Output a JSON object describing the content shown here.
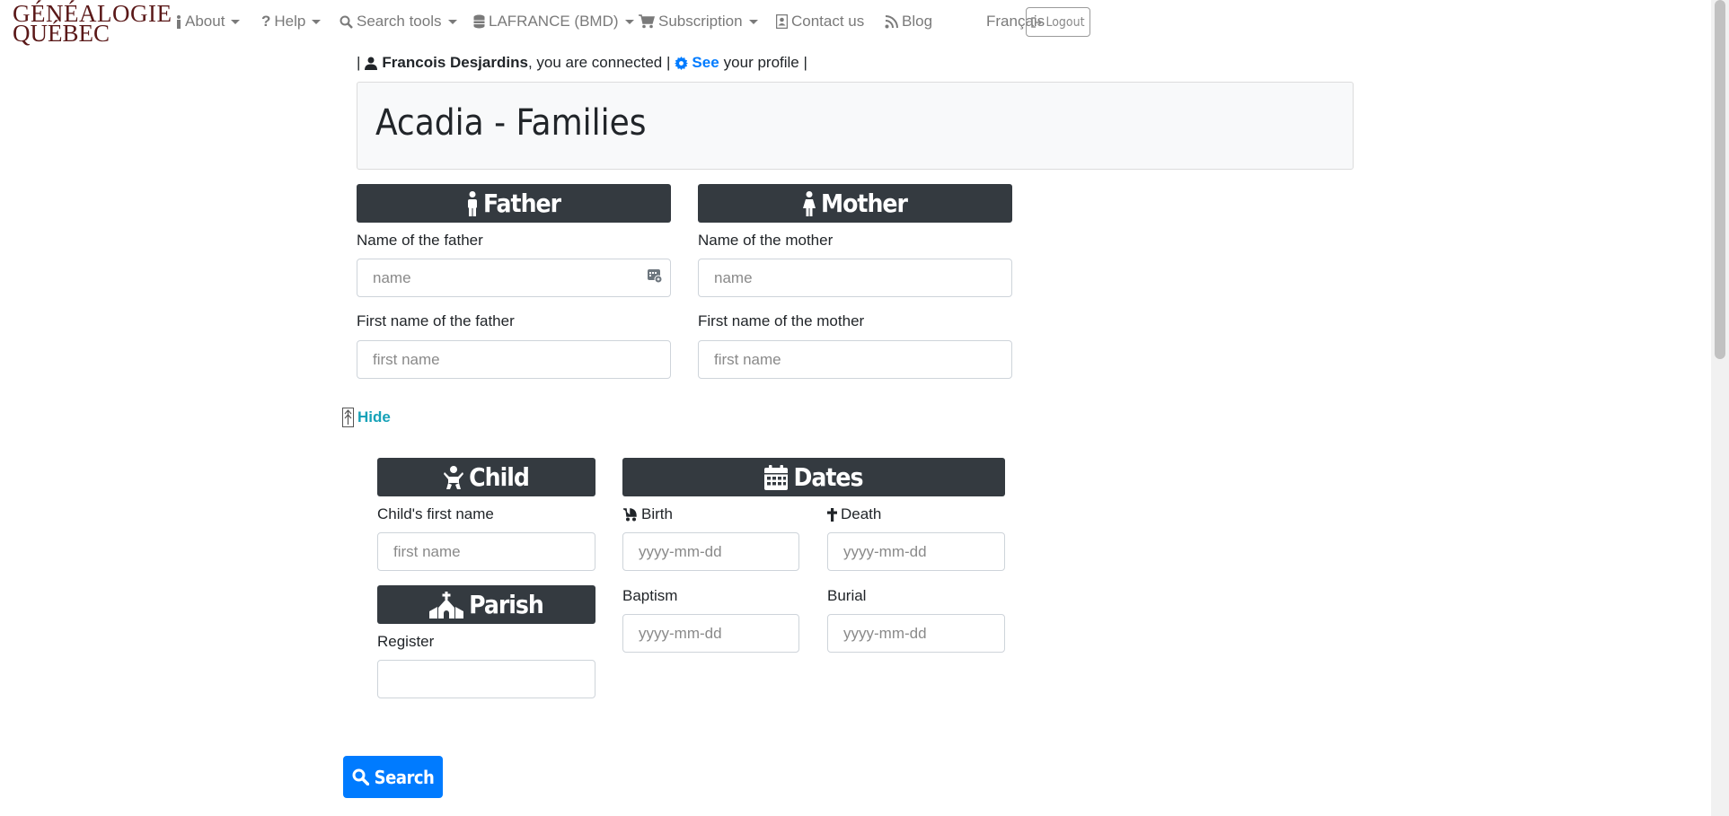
{
  "logo": {
    "line1": "GÉNÉALOGIE",
    "line2": "QUÉBEC"
  },
  "nav": {
    "about": "About",
    "help": "Help",
    "search_tools": "Search tools",
    "database": "LAFRANCE (BMD)",
    "subscription": "Subscription",
    "contact": "Contact us",
    "blog": "Blog",
    "language": "Français",
    "logout": "Logout"
  },
  "user": {
    "name": "Francois Desjardins",
    "connected_text": ", you are connected |",
    "see": "See",
    "profile_text": "your profile |"
  },
  "page": {
    "title": "Acadia - Families"
  },
  "father": {
    "header": "Father",
    "name_label": "Name of the father",
    "name_placeholder": "name",
    "first_label": "First name of the father",
    "first_placeholder": "first name"
  },
  "mother": {
    "header": "Mother",
    "name_label": "Name of the mother",
    "name_placeholder": "name",
    "first_label": "First name of the mother",
    "first_placeholder": "first name"
  },
  "toggle": {
    "label": "Hide"
  },
  "child": {
    "header": "Child",
    "first_label": "Child's first name",
    "first_placeholder": "first name"
  },
  "dates": {
    "header": "Dates",
    "birth_label": "Birth",
    "death_label": "Death",
    "baptism_label": "Baptism",
    "burial_label": "Burial",
    "placeholder": "yyyy-mm-dd"
  },
  "parish": {
    "header": "Parish",
    "register_label": "Register",
    "register_value": ""
  },
  "search": {
    "label": "Search"
  },
  "colors": {
    "header_bg": "#343a40",
    "primary": "#007bff",
    "info": "#17a2b8",
    "logo": "#5a1818"
  }
}
